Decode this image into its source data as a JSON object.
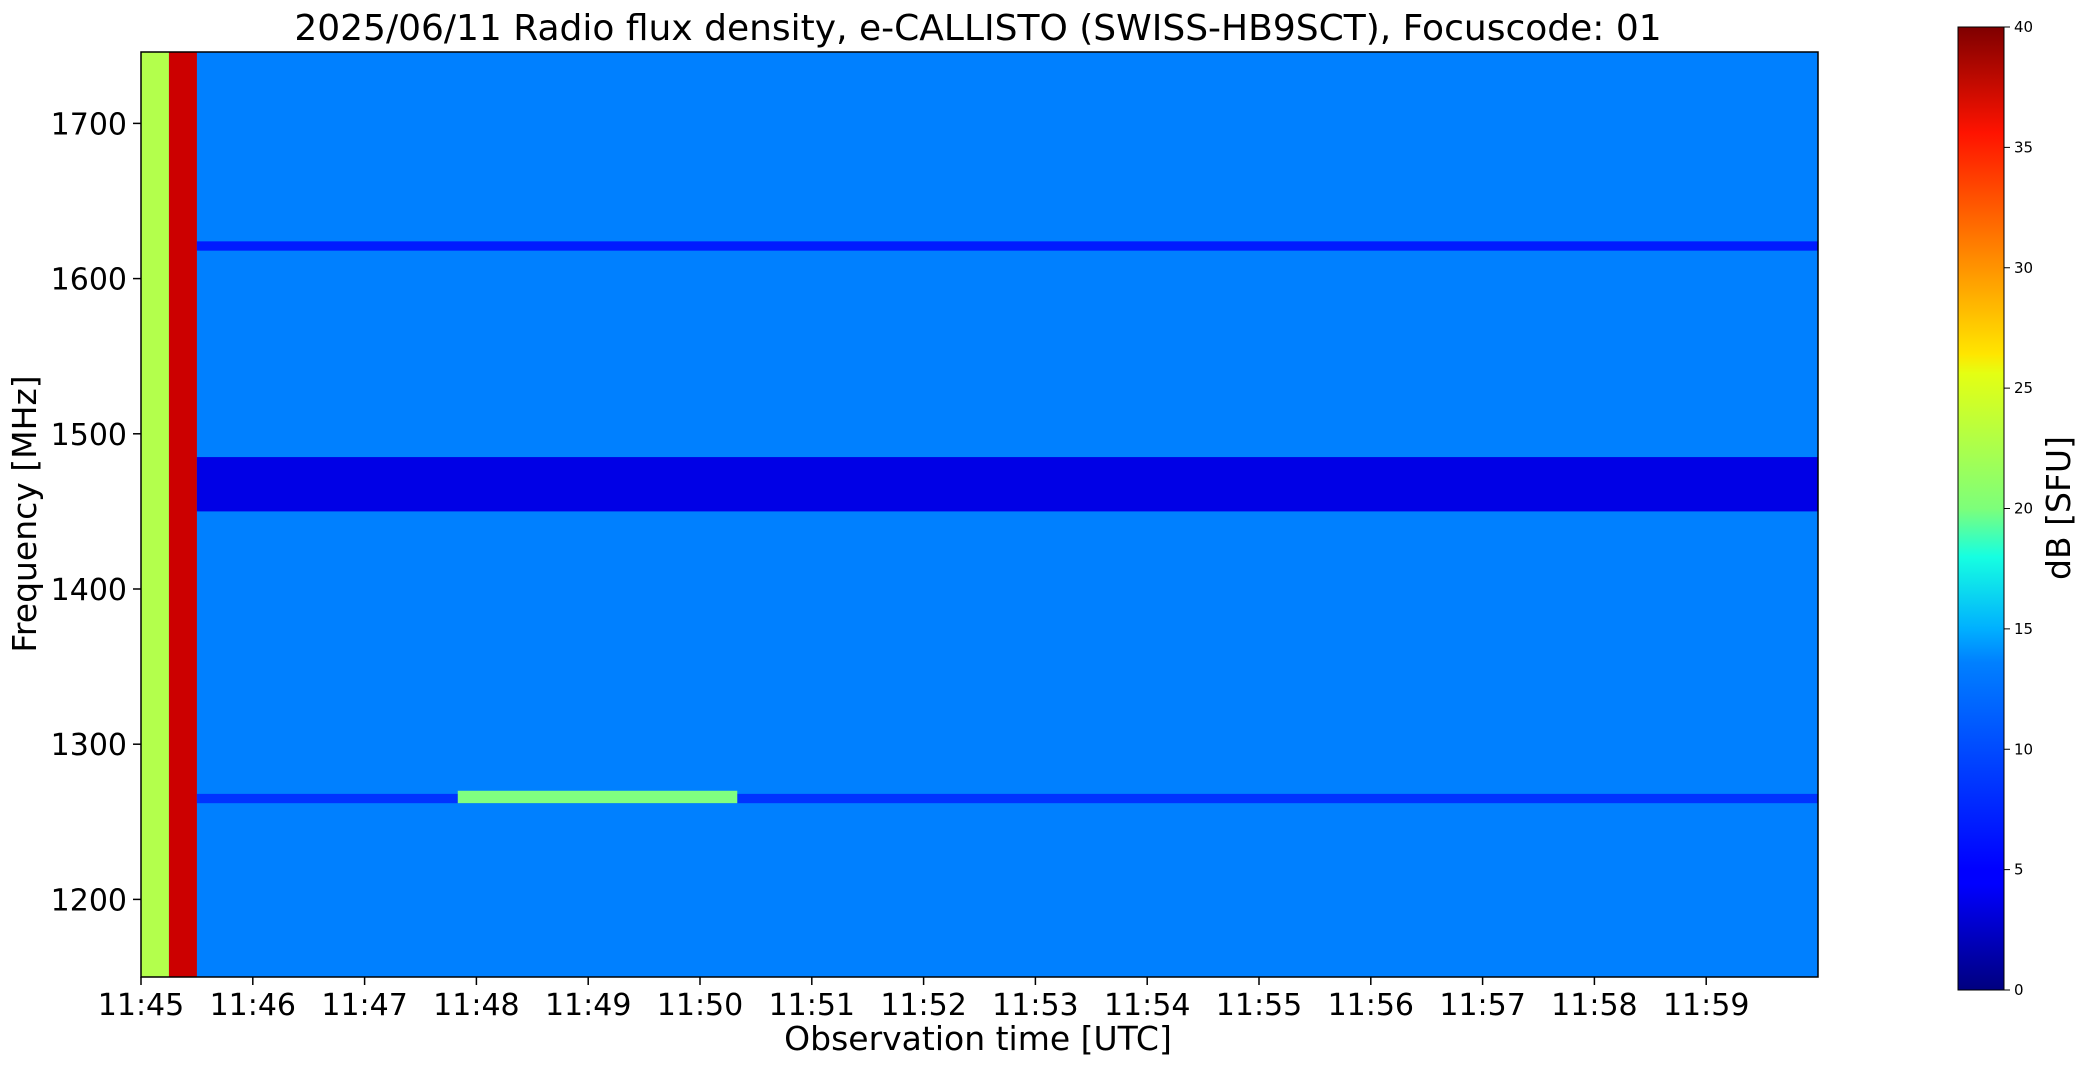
{
  "chart_data": {
    "type": "heatmap",
    "title": "2025/06/11  Radio flux density, e-CALLISTO (SWISS-HB9SCT), Focuscode: 01",
    "xlabel": "Observation time [UTC]",
    "ylabel": "Frequency [MHz]",
    "colorbar_label": "dB [SFU]",
    "colormap": "jet",
    "x_ticks": [
      "11:45",
      "11:46",
      "11:47",
      "11:48",
      "11:49",
      "11:50",
      "11:51",
      "11:52",
      "11:53",
      "11:54",
      "11:55",
      "11:56",
      "11:57",
      "11:58",
      "11:59"
    ],
    "xlim": [
      "11:45",
      "12:00"
    ],
    "y_ticks": [
      1200,
      1300,
      1400,
      1500,
      1600,
      1700
    ],
    "ylim": [
      1150,
      1746
    ],
    "colorbar_ticks": [
      0,
      5,
      10,
      15,
      20,
      25,
      30,
      35,
      40
    ],
    "clim": [
      0,
      40
    ],
    "background_level": 10,
    "features": [
      {
        "time_start": "11:45:00",
        "time_end": "11:45:15",
        "freq_start": 1150,
        "freq_end": 1746,
        "level": 22
      },
      {
        "time_start": "11:45:15",
        "time_end": "11:45:30",
        "freq_start": 1150,
        "freq_end": 1746,
        "level": 37
      },
      {
        "time_start": "11:45:30",
        "time_end": "12:00:00",
        "freq_start": 1450,
        "freq_end": 1485,
        "level": 4
      },
      {
        "time_start": "11:45:30",
        "time_end": "12:00:00",
        "freq_start": 1618,
        "freq_end": 1624,
        "level": 6
      },
      {
        "time_start": "11:45:30",
        "time_end": "12:00:00",
        "freq_start": 1262,
        "freq_end": 1268,
        "level": 7
      },
      {
        "time_start": "11:47:50",
        "time_end": "11:50:20",
        "freq_start": 1262,
        "freq_end": 1270,
        "level": 20
      }
    ]
  }
}
